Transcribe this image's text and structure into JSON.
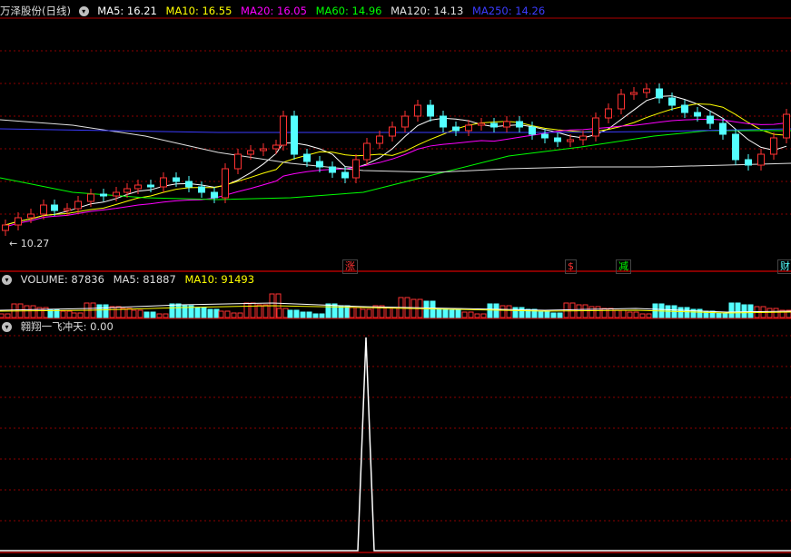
{
  "main_header": {
    "title": "万泽股份(日线)",
    "ma5": "MA5: 16.21",
    "ma10": "MA10: 16.55",
    "ma20": "MA20: 16.05",
    "ma60": "MA60: 14.96",
    "ma120": "MA120: 14.13",
    "ma250": "MA250: 14.26"
  },
  "low_label": "10.27",
  "event_tags": [
    "涨",
    "$",
    "减",
    "财"
  ],
  "volume_header": {
    "volume": "VOLUME: 87836",
    "ma5": "MA5: 81887",
    "ma10": "MA10: 91493"
  },
  "indicator_header": {
    "name": "翱翔一飞冲天",
    "value": ": 0.00"
  },
  "colors": {
    "up": "#ff3232",
    "down": "#54ffff",
    "ma5": "#ffffff",
    "ma10": "#ffff00",
    "ma20": "#ff00ff",
    "ma60": "#00ff00",
    "ma120": "#e0e0e0",
    "ma250": "#3c3cff",
    "grid": "#8b0000"
  },
  "icon": "chevron-down-icon"
}
